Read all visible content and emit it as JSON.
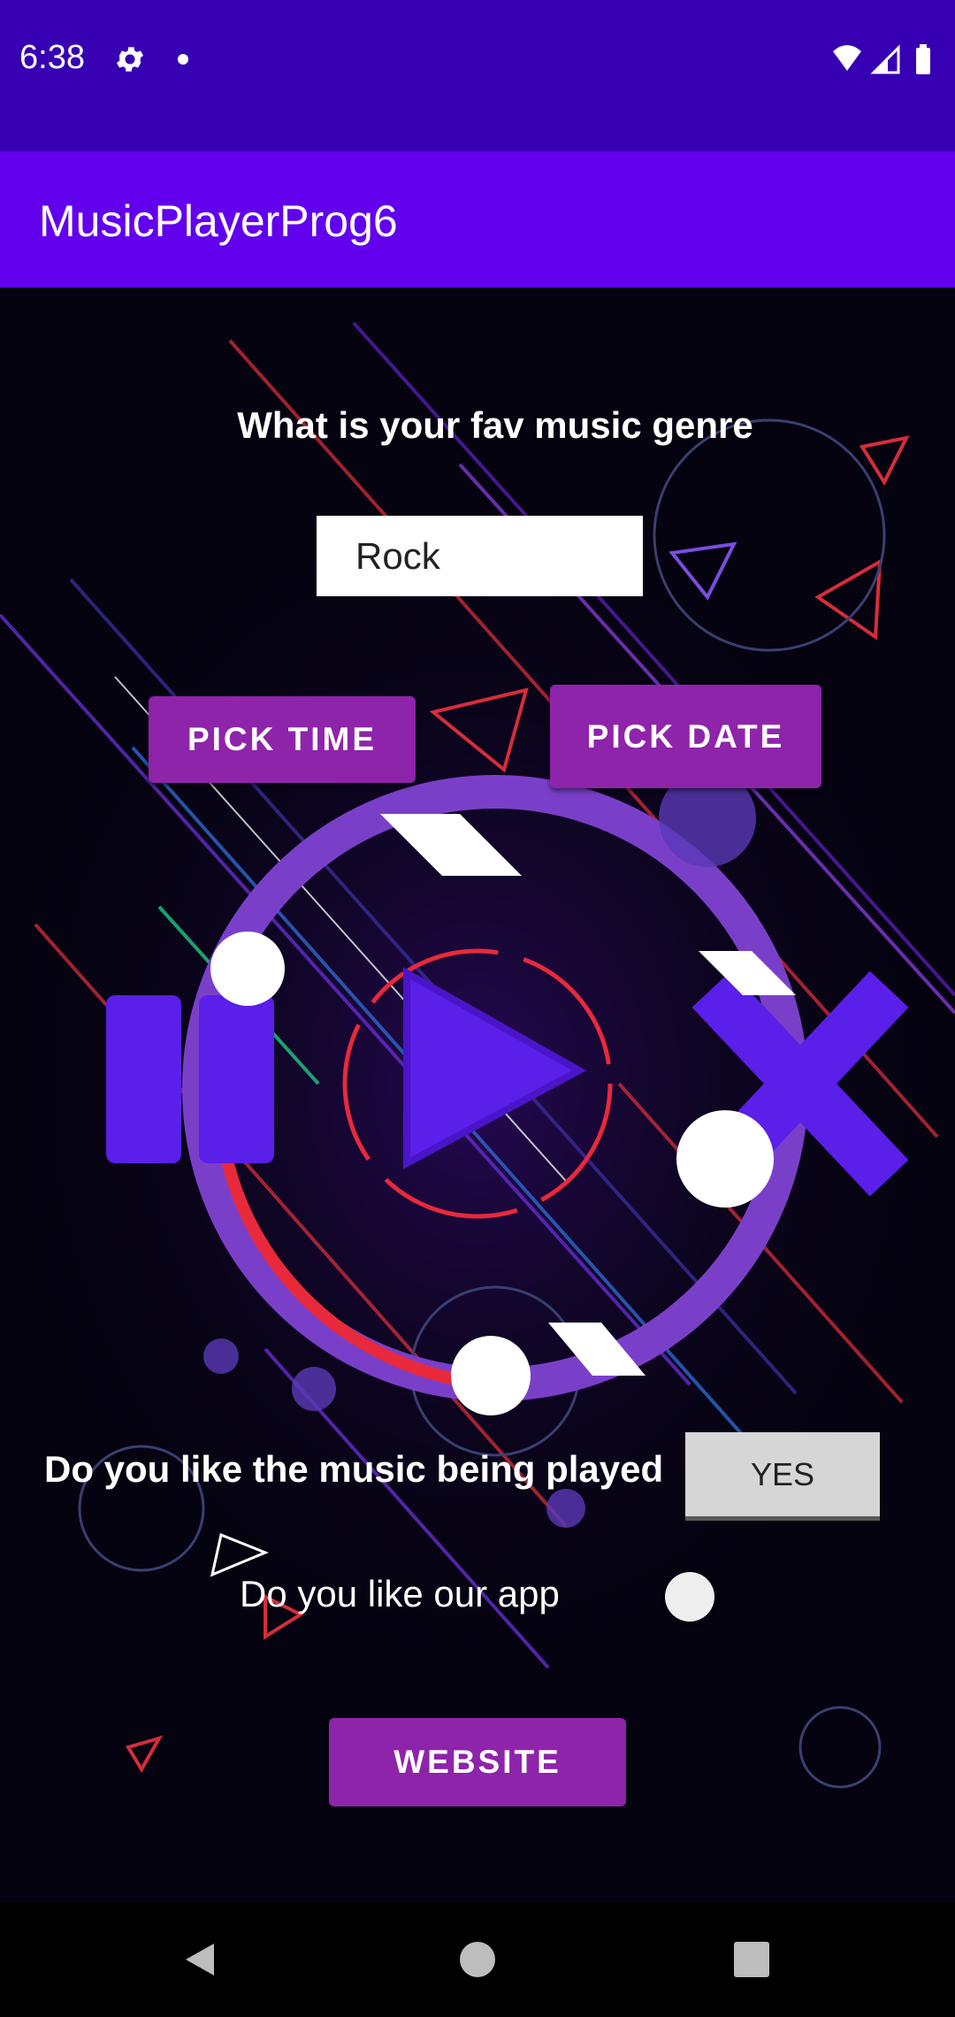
{
  "status_bar": {
    "time": "6:38",
    "icons": [
      "settings-icon",
      "notification-dot-icon",
      "wifi-icon",
      "cell-signal-icon",
      "battery-icon"
    ]
  },
  "app_bar": {
    "title": "MusicPlayerProg6",
    "color": "#6200ee"
  },
  "main": {
    "genre_question": "What is your fav music genre",
    "genre_value": "Rock",
    "pick_time_label": "PICK TIME",
    "pick_date_label": "PICK DATE",
    "like_music_question": "Do you like the music being played",
    "like_music_toggle": "YES",
    "like_app_question": "Do you like our app",
    "like_app_switch_on": false,
    "website_label": "WEBSITE",
    "button_color": "#8e24aa"
  },
  "nav_bar": {
    "icons": [
      "back-icon",
      "home-icon",
      "recents-icon"
    ]
  }
}
